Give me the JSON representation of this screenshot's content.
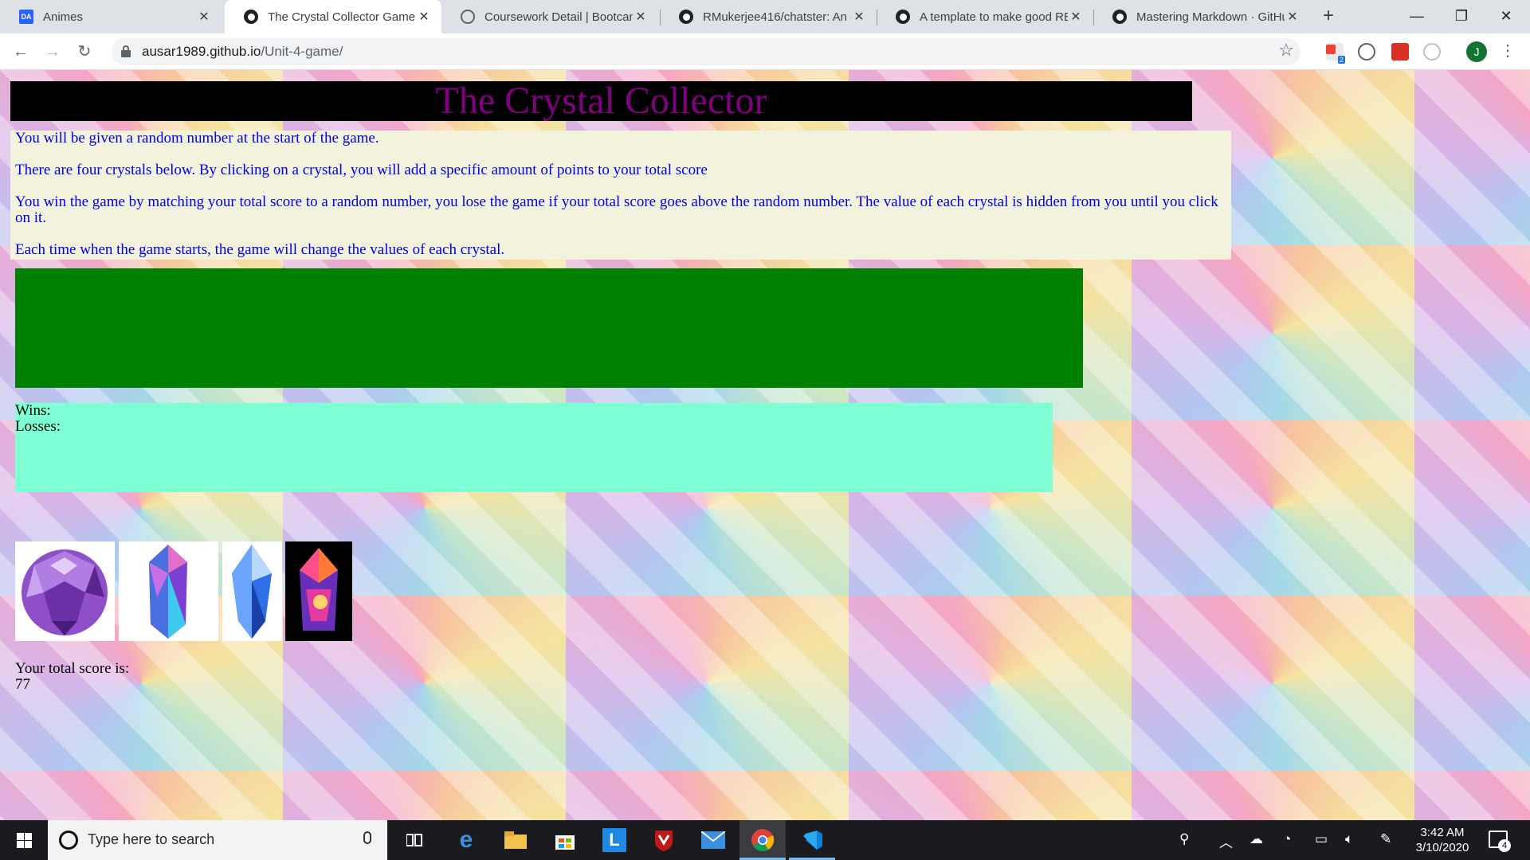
{
  "browser": {
    "tabs": [
      {
        "title": "Animes",
        "favicon": "deviantart-icon"
      },
      {
        "title": "The Crystal Collector Game",
        "favicon": "github-icon",
        "active": true
      },
      {
        "title": "Coursework Detail | Bootcam",
        "favicon": "globe-icon"
      },
      {
        "title": "RMukerjee416/chatster: An a",
        "favicon": "github-icon"
      },
      {
        "title": "A template to make good RE",
        "favicon": "github-icon"
      },
      {
        "title": "Mastering Markdown · GitHu",
        "favicon": "github-icon"
      }
    ],
    "favicon_da_text": "DA",
    "address": {
      "host": "ausar1989.github.io",
      "path": "/Unit-4-game/"
    },
    "profile_initial": "J",
    "extension_badge": "2"
  },
  "page": {
    "title": "The Crystal Collector",
    "rules": [
      "You will be given a random number at the start of the game.",
      "There are four crystals below. By clicking on a crystal, you will add a specific amount of points to your total score",
      "You win the game by matching your total score to a random number, you lose the game if your total score goes above the random number. The value of each crystal is hidden from you until you click on it.",
      "Each time when the game starts, the game will change the values of each crystal."
    ],
    "wins_label": "Wins:",
    "losses_label": "Losses:",
    "crystals": [
      {
        "name": "purple-sphere-crystal"
      },
      {
        "name": "violet-blue-crystal"
      },
      {
        "name": "blue-crystal"
      },
      {
        "name": "fire-crystal"
      }
    ],
    "score_label": "Your total score is:",
    "score_value": "77",
    "colors": {
      "title_bg": "#000000",
      "title_fg": "#800080",
      "rules_bg": "#f3f2dd",
      "rules_fg": "#0000ee",
      "target_bg": "#008000",
      "stats_bg": "#7fffd4"
    }
  },
  "taskbar": {
    "search_placeholder": "Type here to search",
    "time": "3:42 AM",
    "date": "3/10/2020",
    "notification_count": "4"
  }
}
